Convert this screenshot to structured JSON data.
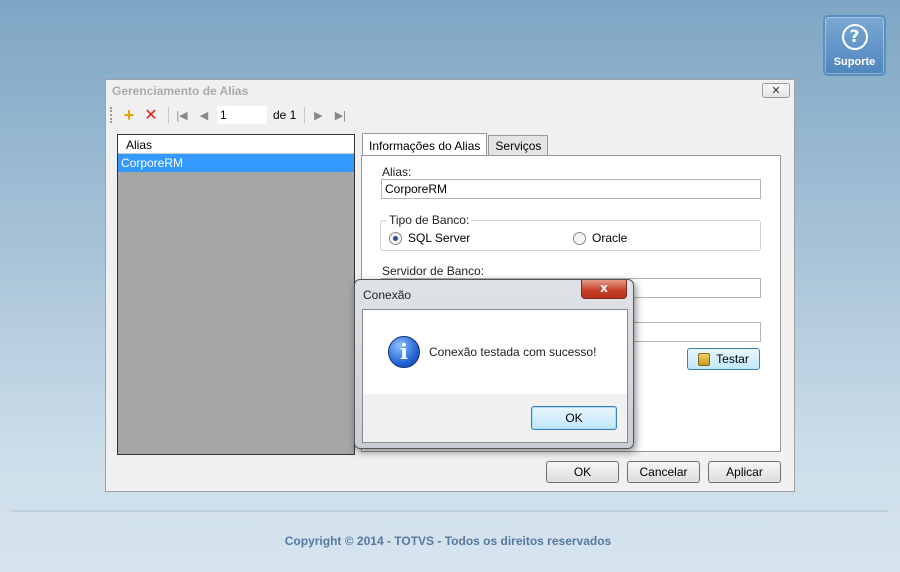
{
  "support": {
    "icon": "question-circle-icon",
    "label": "Suporte"
  },
  "window": {
    "title": "Gerenciamento de Alias",
    "close_glyph": "✕"
  },
  "toolbar": {
    "page_value": "1",
    "page_of": "de 1",
    "icons": [
      "add-icon",
      "delete-icon",
      "first-page-icon",
      "prev-page-icon",
      "next-page-icon",
      "last-page-icon"
    ]
  },
  "alias_list": {
    "header": "Alias",
    "items": [
      {
        "label": "CorporeRM",
        "selected": true
      }
    ]
  },
  "tabs": [
    {
      "label": "Informações do Alias",
      "active": true
    },
    {
      "label": "Serviços",
      "active": false
    }
  ],
  "form": {
    "alias_label": "Alias:",
    "alias_value": "CorporeRM",
    "db_type_label": "Tipo de Banco:",
    "db_types": [
      {
        "label": "SQL Server",
        "checked": true
      },
      {
        "label": "Oracle",
        "checked": false
      }
    ],
    "server_label": "Servidor de Banco:",
    "server_value": "",
    "database_value": "",
    "test_button": "Testar"
  },
  "buttons": {
    "ok": "OK",
    "cancel": "Cancelar",
    "apply": "Aplicar"
  },
  "dialog": {
    "title": "Conexão",
    "close_glyph": "x",
    "icon": "info-icon",
    "message": "Conexão testada com sucesso!",
    "ok": "OK"
  },
  "footer": {
    "copyright": "Copyright © 2014 - TOTVS - Todos os direitos reservados"
  },
  "colors": {
    "selection": "#3399ff",
    "support_button": "#5a8fc0",
    "dialog_close": "#c7432b",
    "copyright": "#5579a0"
  }
}
